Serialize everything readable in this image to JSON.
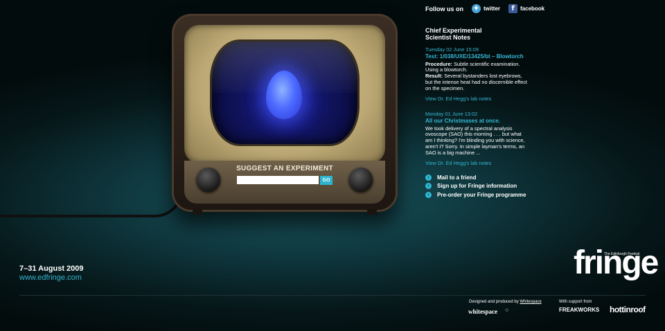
{
  "suggest": {
    "title": "SUGGEST AN EXPERIMENT",
    "input_value": "",
    "go_label": "GO"
  },
  "social": {
    "follow_label": "Follow us on",
    "twitter_label": "twitter",
    "facebook_label": "facebook"
  },
  "notes": {
    "title_line1": "Chief Experimental",
    "title_line2": "Scientist Notes",
    "entries": [
      {
        "date": "Tuesday 02 June 15:09",
        "headline": "Test: 1/038/UXE/13425/bt – Blowtorch",
        "procedure_label": "Procedure:",
        "procedure_text": "Subtle scientific examination. Using a blowtorch.",
        "result_label": "Result:",
        "result_text": "Several bystanders lost eyebrows, but the intense heat had no discernible effect on the specimen.",
        "link": "View Dr. Ed Hegg's lab notes"
      },
      {
        "date": "Monday 01 June 13:02",
        "headline": "All our Christmases at once.",
        "body": "We took delivery of a spectral analysis ovoscope (SAO) this morning . . . but what am I thinking? I'm blinding you with science, aren't I? Sorry. In simple layman's terms, an SAO is a big machine ...",
        "link": "View Dr. Ed Hegg's lab notes"
      }
    ]
  },
  "actions": [
    {
      "label": "Mail to a friend"
    },
    {
      "label": "Sign up for Fringe information"
    },
    {
      "label": "Pre-order your Fringe programme"
    }
  ],
  "footer": {
    "dates": "7–31 August 2009",
    "website": "www.edfringe.com",
    "logo_text": "fringe",
    "logo_sub": "The Edinburgh Festival",
    "designed_by": "Designed and produced by",
    "designer": "Whitespace",
    "designer_logo": "whitespace",
    "support_label": "With support from",
    "sponsor1": "FREAKWORKS",
    "sponsor2": "hottinroof"
  },
  "colors": {
    "accent": "#35b6d2",
    "background": "#0d3238"
  }
}
